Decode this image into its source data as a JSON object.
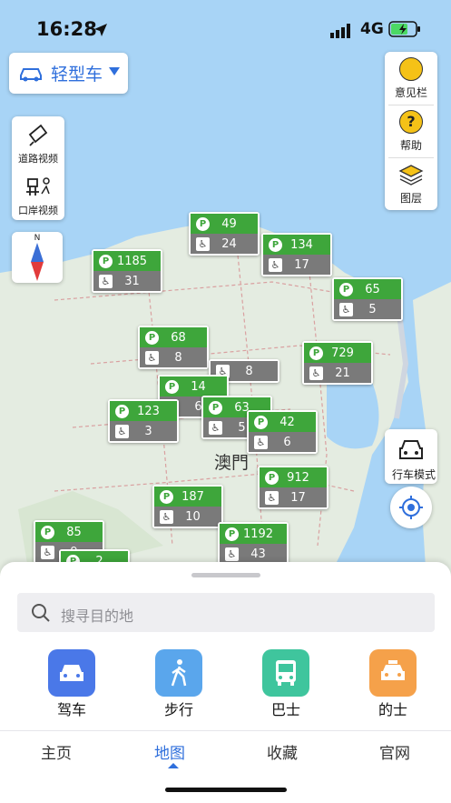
{
  "status": {
    "time": "16:28",
    "network": "4G"
  },
  "vehicle": {
    "label": "轻型车"
  },
  "tools": [
    {
      "label": "意见栏",
      "icon": "feedback-icon"
    },
    {
      "label": "帮助",
      "icon": "help-icon"
    },
    {
      "label": "图层",
      "icon": "layers-icon"
    }
  ],
  "cams": [
    {
      "label": "道路视频",
      "icon": "road-camera-icon"
    },
    {
      "label": "口岸视频",
      "icon": "border-camera-icon"
    }
  ],
  "compass": {
    "north": "N"
  },
  "map": {
    "city": "澳門"
  },
  "drive_mode": {
    "label": "行车模式"
  },
  "parking": [
    {
      "spaces": "49",
      "disabled": "24"
    },
    {
      "spaces": "134",
      "disabled": "17"
    },
    {
      "spaces": "1185",
      "disabled": "31"
    },
    {
      "spaces": "65",
      "disabled": "5"
    },
    {
      "spaces": "68",
      "disabled": "8"
    },
    {
      "spaces": "729",
      "disabled": "21"
    },
    {
      "spaces": "",
      "disabled": "8"
    },
    {
      "spaces": "14",
      "disabled": "6"
    },
    {
      "spaces": "123",
      "disabled": "3"
    },
    {
      "spaces": "63",
      "disabled": "5"
    },
    {
      "spaces": "42",
      "disabled": "6"
    },
    {
      "spaces": "912",
      "disabled": "17"
    },
    {
      "spaces": "187",
      "disabled": "10"
    },
    {
      "spaces": "1192",
      "disabled": "43"
    },
    {
      "spaces": "85",
      "disabled": "9"
    },
    {
      "spaces": "",
      "disabled": "2"
    }
  ],
  "search": {
    "placeholder": "搜寻目的地"
  },
  "modes": [
    {
      "label": "驾车",
      "color": "#4a78e8"
    },
    {
      "label": "步行",
      "color": "#5aa6ec"
    },
    {
      "label": "巴士",
      "color": "#3fc59d"
    },
    {
      "label": "的士",
      "color": "#f5a14a"
    }
  ],
  "tabs": [
    {
      "label": "主页"
    },
    {
      "label": "地图",
      "active": true
    },
    {
      "label": "收藏"
    },
    {
      "label": "官网"
    }
  ]
}
